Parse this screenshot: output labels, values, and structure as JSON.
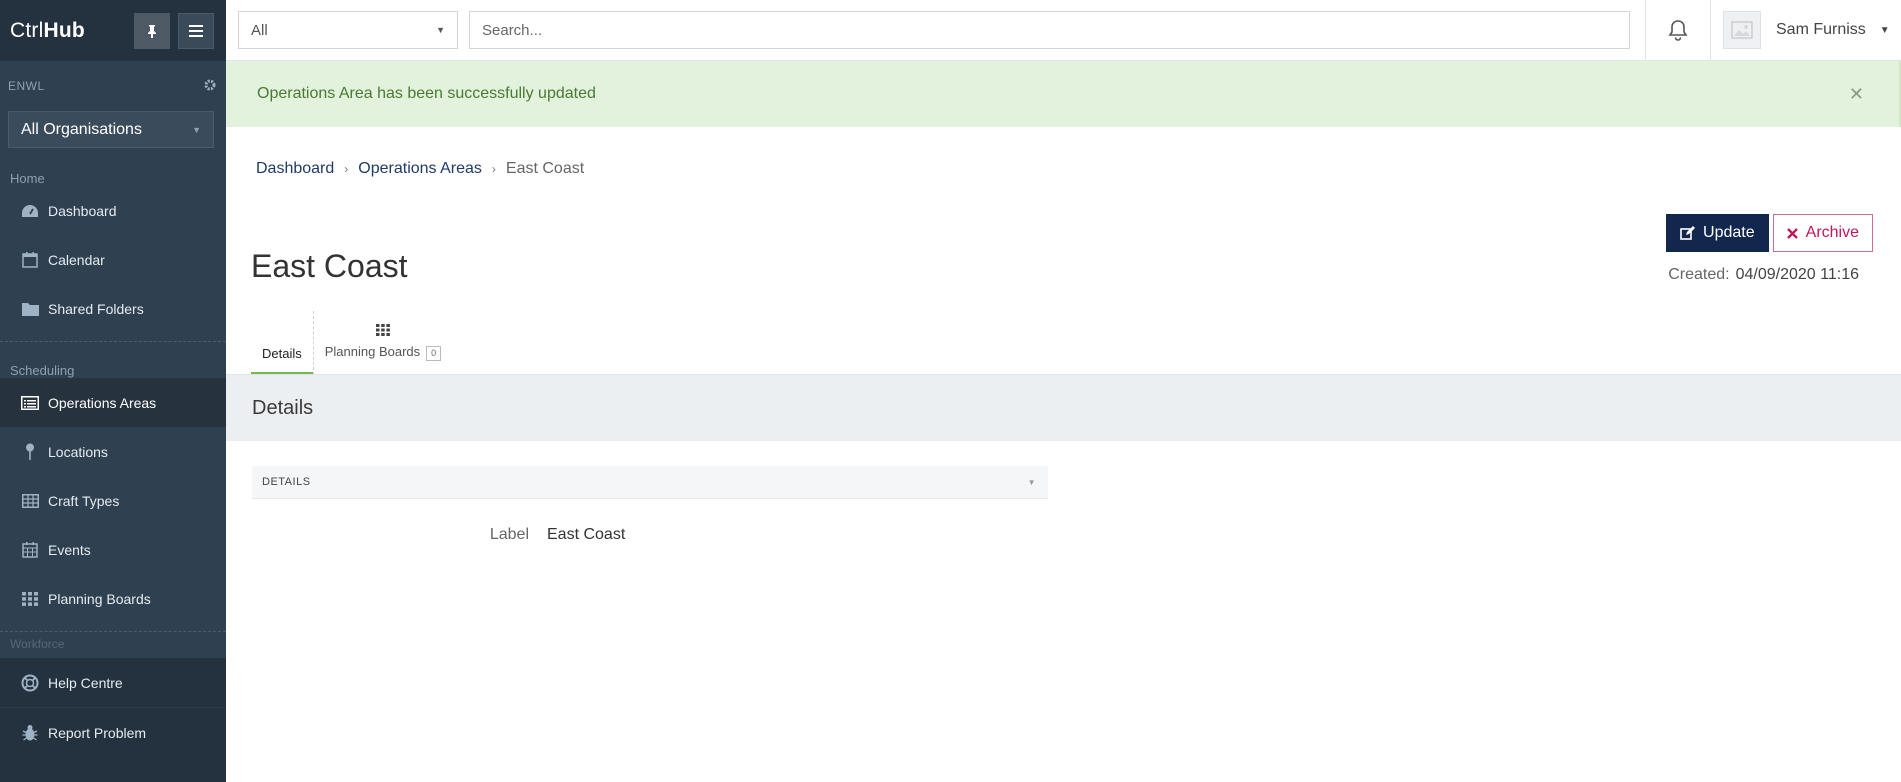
{
  "brand": {
    "prefix": "Ctrl",
    "bold": "Hub"
  },
  "sidebar": {
    "org_label": "ENWL",
    "org_select": "All Organisations",
    "sections": [
      {
        "label": "Home",
        "items": [
          {
            "label": "Dashboard",
            "icon": "dashboard-icon"
          },
          {
            "label": "Calendar",
            "icon": "calendar-icon"
          },
          {
            "label": "Shared Folders",
            "icon": "folder-icon"
          }
        ]
      },
      {
        "label": "Scheduling",
        "items": [
          {
            "label": "Operations Areas",
            "icon": "list-icon",
            "active": true
          },
          {
            "label": "Locations",
            "icon": "pin-icon"
          },
          {
            "label": "Craft Types",
            "icon": "table-icon"
          },
          {
            "label": "Events",
            "icon": "calendar-grid-icon"
          },
          {
            "label": "Planning Boards",
            "icon": "grid-icon"
          }
        ]
      }
    ],
    "ghost_section": "Workforce",
    "bottom": [
      {
        "label": "Help Centre",
        "icon": "lifebuoy-icon"
      },
      {
        "label": "Report Problem",
        "icon": "bug-icon"
      }
    ]
  },
  "topbar": {
    "scope": "All",
    "search_placeholder": "Search...",
    "user_name": "Sam Furniss"
  },
  "alert": {
    "message": "Operations Area has been successfully updated"
  },
  "breadcrumb": {
    "items": [
      "Dashboard",
      "Operations Areas"
    ],
    "current": "East Coast"
  },
  "page": {
    "title": "East Coast",
    "update_label": "Update",
    "archive_label": "Archive",
    "created_label": "Created:",
    "created_value": "04/09/2020 11:16"
  },
  "tabs": [
    {
      "label": "Details",
      "active": true
    },
    {
      "label": "Planning Boards",
      "badge": "0"
    }
  ],
  "details": {
    "section_title": "Details",
    "card_title": "DETAILS",
    "fields": [
      {
        "label": "Label",
        "value": "East Coast"
      }
    ]
  },
  "colors": {
    "sidebar": "#2f4050",
    "primary": "#12274d",
    "archive": "#c2185b",
    "success_bg": "#e3f2dc",
    "tab_active": "#7ab648"
  }
}
